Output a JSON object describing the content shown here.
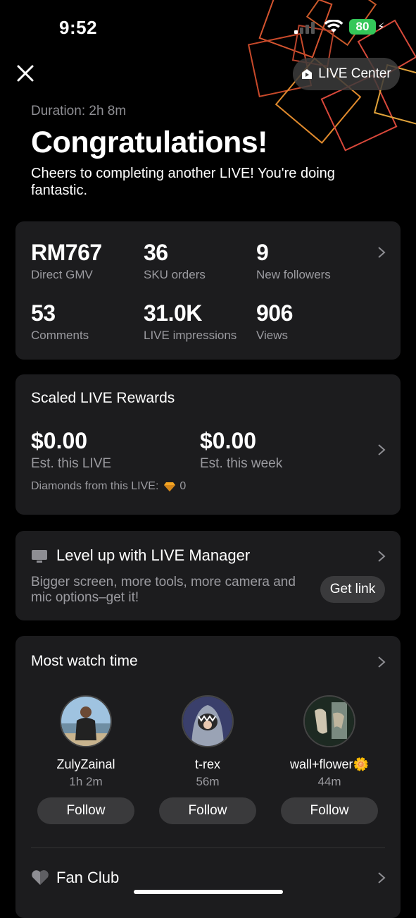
{
  "status_bar": {
    "time": "9:52",
    "battery": "80"
  },
  "header": {
    "live_center_label": "LIVE Center"
  },
  "summary": {
    "duration": "Duration: 2h 8m",
    "title": "Congratulations!",
    "message": "Cheers to completing another LIVE! You're doing fantastic."
  },
  "stats": [
    {
      "value": "RM767",
      "label": "Direct GMV"
    },
    {
      "value": "36",
      "label": "SKU orders"
    },
    {
      "value": "9",
      "label": "New followers"
    },
    {
      "value": "53",
      "label": "Comments"
    },
    {
      "value": "31.0K",
      "label": "LIVE impressions"
    },
    {
      "value": "906",
      "label": "Views"
    }
  ],
  "rewards": {
    "title": "Scaled LIVE Rewards",
    "live_value": "$0.00",
    "live_label": "Est. this LIVE",
    "week_value": "$0.00",
    "week_label": "Est. this week",
    "diamonds_label": "Diamonds from this LIVE:",
    "diamonds_count": "0"
  },
  "live_manager": {
    "title": "Level up with LIVE Manager",
    "description": "Bigger screen, more tools, more camera and mic options–get it!",
    "button": "Get link"
  },
  "watch_time": {
    "title": "Most watch time",
    "viewers": [
      {
        "name": "ZulyZainal",
        "time": "1h 2m",
        "button": "Follow"
      },
      {
        "name": "t-rex",
        "time": "56m",
        "button": "Follow"
      },
      {
        "name": "wall+flower🌼",
        "time": "44m",
        "button": "Follow"
      }
    ]
  },
  "fan_club": {
    "title": "Fan Club"
  },
  "colors": {
    "card_bg": "#1c1c1e",
    "button_bg": "#3a3a3c",
    "battery": "#34c759",
    "muted_text": "#9b9ba0"
  }
}
